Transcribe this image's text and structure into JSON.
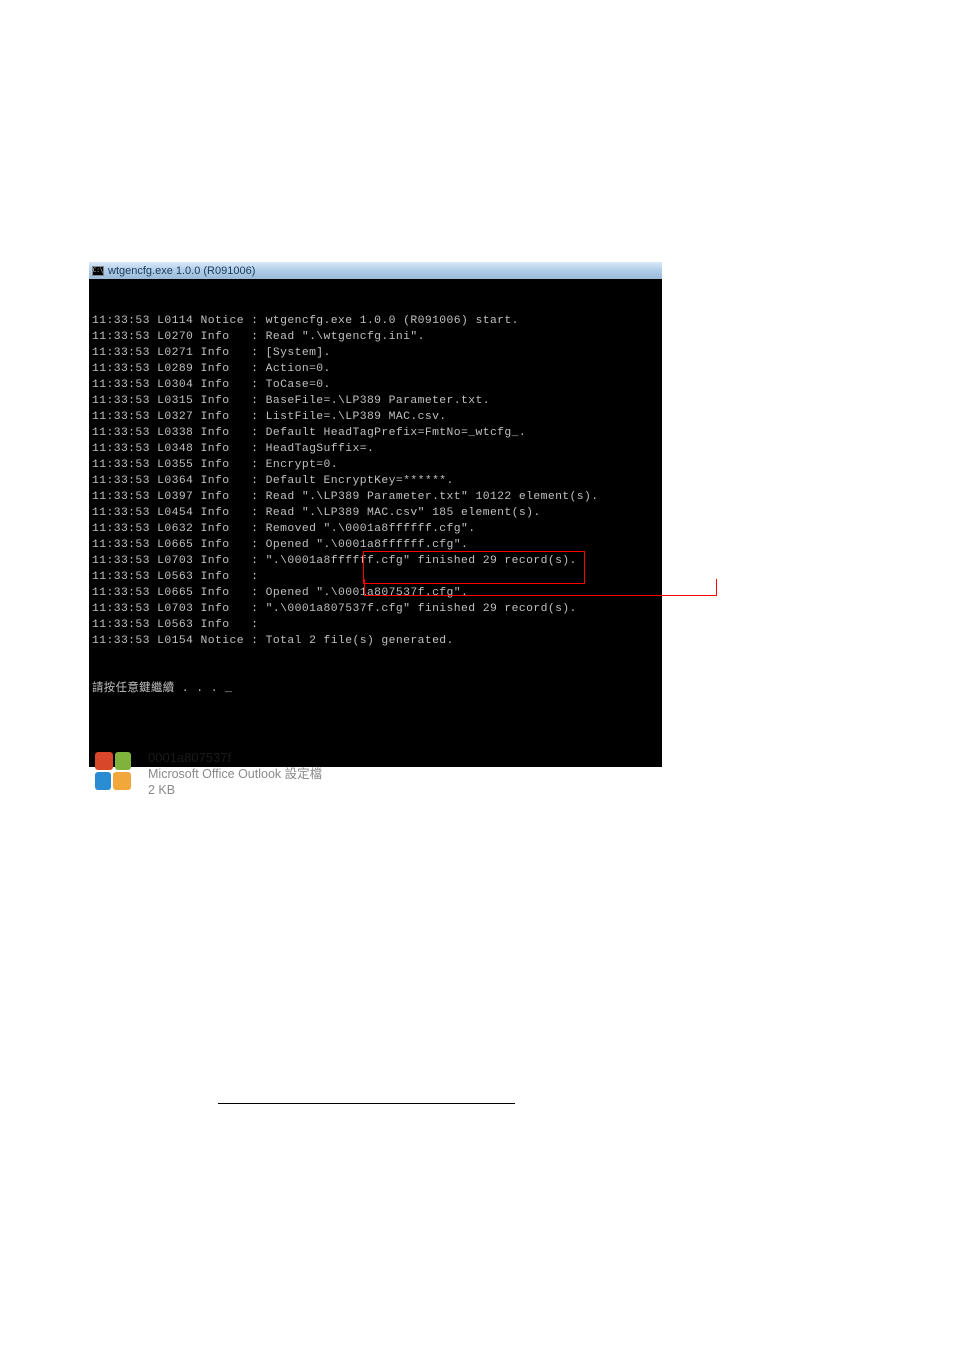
{
  "console": {
    "title_prefix": "C:\\",
    "title": "wtgencfg.exe 1.0.0 (R091006)",
    "lines": [
      {
        "time": "11:33:53",
        "loc": "L0114",
        "level": "Notice",
        "msg": "wtgencfg.exe 1.0.0 (R091006) start."
      },
      {
        "time": "11:33:53",
        "loc": "L0270",
        "level": "Info  ",
        "msg": "Read \".\\wtgencfg.ini\"."
      },
      {
        "time": "11:33:53",
        "loc": "L0271",
        "level": "Info  ",
        "msg": "[System]."
      },
      {
        "time": "11:33:53",
        "loc": "L0289",
        "level": "Info  ",
        "msg": "Action=0."
      },
      {
        "time": "11:33:53",
        "loc": "L0304",
        "level": "Info  ",
        "msg": "ToCase=0."
      },
      {
        "time": "11:33:53",
        "loc": "L0315",
        "level": "Info  ",
        "msg": "BaseFile=.\\LP389 Parameter.txt."
      },
      {
        "time": "11:33:53",
        "loc": "L0327",
        "level": "Info  ",
        "msg": "ListFile=.\\LP389 MAC.csv."
      },
      {
        "time": "11:33:53",
        "loc": "L0338",
        "level": "Info  ",
        "msg": "Default HeadTagPrefix=FmtNo=_wtcfg_."
      },
      {
        "time": "11:33:53",
        "loc": "L0348",
        "level": "Info  ",
        "msg": "HeadTagSuffix=."
      },
      {
        "time": "11:33:53",
        "loc": "L0355",
        "level": "Info  ",
        "msg": "Encrypt=0."
      },
      {
        "time": "11:33:53",
        "loc": "L0364",
        "level": "Info  ",
        "msg": "Default EncryptKey=******."
      },
      {
        "time": "11:33:53",
        "loc": "L0397",
        "level": "Info  ",
        "msg": "Read \".\\LP389 Parameter.txt\" 10122 element(s)."
      },
      {
        "time": "11:33:53",
        "loc": "L0454",
        "level": "Info  ",
        "msg": "Read \".\\LP389 MAC.csv\" 185 element(s)."
      },
      {
        "time": "11:33:53",
        "loc": "L0632",
        "level": "Info  ",
        "msg": "Removed \".\\0001a8ffffff.cfg\"."
      },
      {
        "time": "11:33:53",
        "loc": "L0665",
        "level": "Info  ",
        "msg": "Opened \".\\0001a8ffffff.cfg\"."
      },
      {
        "time": "11:33:53",
        "loc": "L0703",
        "level": "Info  ",
        "msg": "\".\\0001a8ffffff.cfg\" finished 29 record(s)."
      },
      {
        "time": "11:33:53",
        "loc": "L0563",
        "level": "Info  ",
        "msg": ""
      },
      {
        "time": "11:33:53",
        "loc": "L0665",
        "level": "Info  ",
        "msg": "Opened \".\\0001a807537f.cfg\"."
      },
      {
        "time": "11:33:53",
        "loc": "L0703",
        "level": "Info  ",
        "msg": "\".\\0001a807537f.cfg\" finished 29 record(s)."
      },
      {
        "time": "11:33:53",
        "loc": "L0563",
        "level": "Info  ",
        "msg": ""
      },
      {
        "time": "11:33:53",
        "loc": "L0154",
        "level": "Notice",
        "msg": "Total 2 file(s) generated."
      }
    ],
    "prompt": "請按任意鍵繼續 . . . _"
  },
  "file": {
    "name": "0001a807537f",
    "type": "Microsoft Office Outlook 設定檔",
    "size": "2 KB"
  }
}
